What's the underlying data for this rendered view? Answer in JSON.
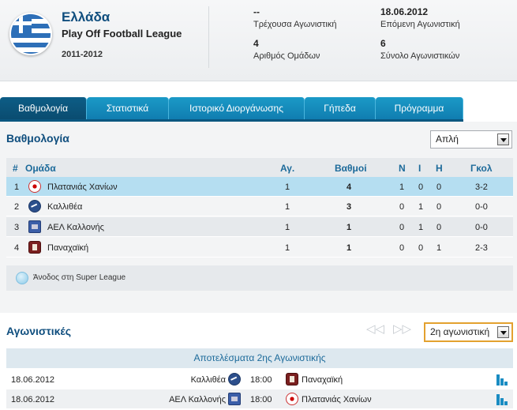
{
  "header": {
    "country": "Ελλάδα",
    "league": "Play Off Football League",
    "season": "2011-2012",
    "current_round_value": "--",
    "current_round_label": "Τρέχουσα Αγωνιστική",
    "next_round_value": "18.06.2012",
    "next_round_label": "Επόμενη Αγωνιστική",
    "teams_value": "4",
    "teams_label": "Αριθμός Ομάδων",
    "total_rounds_value": "6",
    "total_rounds_label": "Σύνολο Αγωνιστικών"
  },
  "tabs": [
    {
      "label": "Βαθμολογία",
      "active": true
    },
    {
      "label": "Στατιστικά",
      "active": false
    },
    {
      "label": "Ιστορικό Διοργάνωσης",
      "active": false
    },
    {
      "label": "Γήπεδα",
      "active": false
    },
    {
      "label": "Πρόγραμμα",
      "active": false
    }
  ],
  "standings": {
    "title": "Βαθμολογία",
    "view_select": "Απλή",
    "columns": {
      "pos": "#",
      "team": "Ομάδα",
      "played": "Αγ.",
      "points": "Βαθμοί",
      "wins": "N",
      "draws": "I",
      "losses": "H",
      "goals": "Γκολ"
    },
    "rows": [
      {
        "pos": "1",
        "team": "Πλατανιάς Χανίων",
        "crest": "platanias-crest",
        "played": "1",
        "points": "4",
        "wins": "1",
        "draws": "0",
        "losses": "0",
        "goals": "3-2"
      },
      {
        "pos": "2",
        "team": "Καλλιθέα",
        "crest": "kallithea-crest",
        "played": "1",
        "points": "3",
        "wins": "0",
        "draws": "1",
        "losses": "0",
        "goals": "0-0"
      },
      {
        "pos": "3",
        "team": "ΑΕΛ Καλλονής",
        "crest": "ael-kallonis-crest",
        "played": "1",
        "points": "1",
        "wins": "0",
        "draws": "1",
        "losses": "0",
        "goals": "0-0"
      },
      {
        "pos": "4",
        "team": "Παναχαϊκή",
        "crest": "panachaiki-crest",
        "played": "1",
        "points": "1",
        "wins": "0",
        "draws": "0",
        "losses": "1",
        "goals": "2-3"
      }
    ],
    "legend": "Άνοδος στη Super League",
    "highlight_color": "#b5def1"
  },
  "fixtures": {
    "title": "Αγωνιστικές",
    "round_select": "2η αγωνιστική",
    "results_header": "Αποτελέσματα 2ης Αγωνιστικής",
    "matches": [
      {
        "date": "18.06.2012",
        "home": "Καλλιθέα",
        "time": "18:00",
        "away": "Παναχαϊκή"
      },
      {
        "date": "18.06.2012",
        "home": "ΑΕΛ Καλλονής",
        "time": "18:00",
        "away": "Πλατανιάς Χανίων"
      }
    ]
  },
  "colors": {
    "accent": "#1b9ac7",
    "active_tab": "#0d5d86",
    "title": "#0f4e7e"
  }
}
